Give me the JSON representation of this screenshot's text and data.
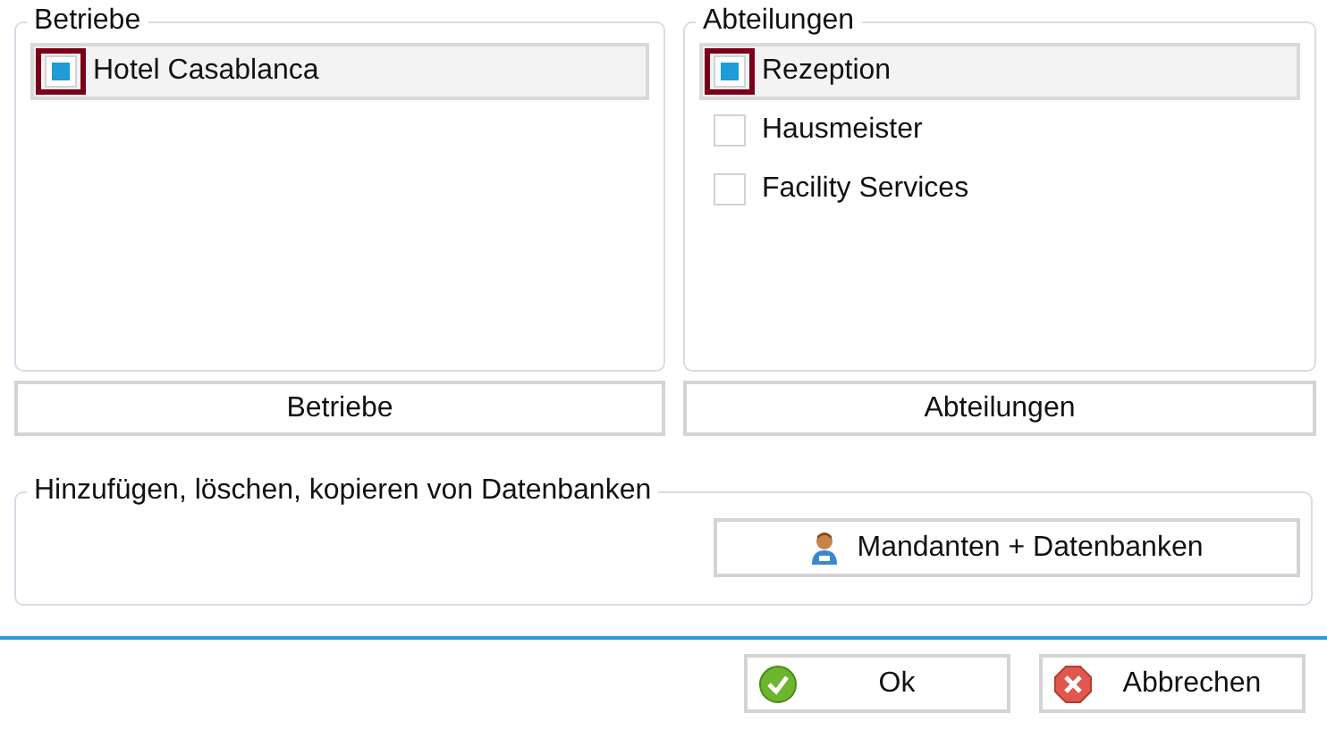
{
  "groups": [
    {
      "title": "Betriebe",
      "items": [
        {
          "label": "Hotel Casablanca",
          "checked": true,
          "selected": true
        }
      ],
      "button": "Betriebe"
    },
    {
      "title": "Abteilungen",
      "items": [
        {
          "label": "Rezeption",
          "checked": true,
          "selected": true
        },
        {
          "label": "Hausmeister",
          "checked": false,
          "selected": false
        },
        {
          "label": "Facility Services",
          "checked": false,
          "selected": false
        }
      ],
      "button": "Abteilungen"
    }
  ],
  "databases": {
    "title": "Hinzufügen, löschen, kopieren von Datenbanken",
    "button": "Mandanten + Datenbanken"
  },
  "footer": {
    "ok": "Ok",
    "cancel": "Abbrechen"
  }
}
